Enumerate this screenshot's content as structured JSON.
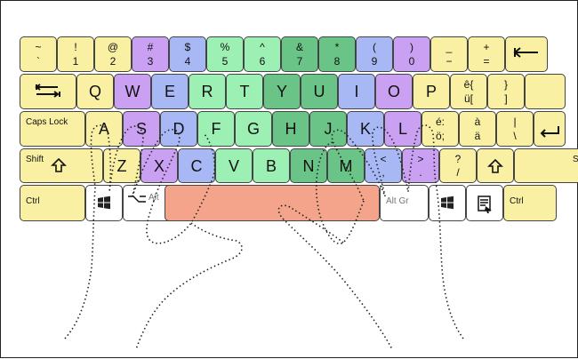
{
  "rows": [
    {
      "name": "number-row",
      "keys": [
        {
          "name": "key-tilde",
          "top": "~",
          "bottom": "`",
          "color": "yellow"
        },
        {
          "name": "key-1",
          "top": "!",
          "bottom": "1",
          "color": "yellow"
        },
        {
          "name": "key-2",
          "top": "@",
          "bottom": "2",
          "color": "yellow"
        },
        {
          "name": "key-3",
          "top": "#",
          "bottom": "3",
          "color": "purple"
        },
        {
          "name": "key-4",
          "top": "$",
          "bottom": "4",
          "color": "blue"
        },
        {
          "name": "key-5",
          "top": "%",
          "bottom": "5",
          "color": "lgreen"
        },
        {
          "name": "key-6",
          "top": "^",
          "bottom": "6",
          "color": "lgreen"
        },
        {
          "name": "key-7",
          "top": "&",
          "bottom": "7",
          "color": "dgreen"
        },
        {
          "name": "key-8",
          "top": "*",
          "bottom": "8",
          "color": "dgreen"
        },
        {
          "name": "key-9",
          "top": "(",
          "bottom": "9",
          "color": "blue"
        },
        {
          "name": "key-0",
          "top": ")",
          "bottom": "0",
          "color": "purple"
        },
        {
          "name": "key-minus",
          "top": "_",
          "bottom": "−",
          "color": "yellow"
        },
        {
          "name": "key-equals",
          "top": "+",
          "bottom": "=",
          "color": "yellow"
        },
        {
          "name": "key-backspace",
          "icon": "backspace-icon",
          "color": "yellow"
        }
      ]
    },
    {
      "name": "qwerty-row",
      "keys": [
        {
          "name": "key-tab",
          "icon": "tab-icon",
          "color": "yellow"
        },
        {
          "name": "key-q",
          "main": "Q",
          "color": "yellow"
        },
        {
          "name": "key-w",
          "main": "W",
          "color": "purple"
        },
        {
          "name": "key-e",
          "main": "E",
          "color": "blue"
        },
        {
          "name": "key-r",
          "main": "R",
          "color": "lgreen"
        },
        {
          "name": "key-t",
          "main": "T",
          "color": "lgreen"
        },
        {
          "name": "key-y",
          "main": "Y",
          "color": "dgreen"
        },
        {
          "name": "key-u",
          "main": "U",
          "color": "dgreen"
        },
        {
          "name": "key-i",
          "main": "I",
          "color": "blue"
        },
        {
          "name": "key-o",
          "main": "O",
          "color": "purple"
        },
        {
          "name": "key-p",
          "main": "P",
          "color": "yellow"
        },
        {
          "name": "key-bracket-left",
          "top": "ê{",
          "bottom": "ü[",
          "color": "yellow"
        },
        {
          "name": "key-bracket-right",
          "top": "}",
          "bottom": "]",
          "color": "yellow"
        },
        {
          "name": "key-enter-upper",
          "color": "yellow"
        }
      ]
    },
    {
      "name": "home-row",
      "keys": [
        {
          "name": "key-caps-lock",
          "label": "Caps Lock",
          "color": "yellow"
        },
        {
          "name": "key-a",
          "main": "A",
          "color": "yellow"
        },
        {
          "name": "key-s",
          "main": "S",
          "color": "purple"
        },
        {
          "name": "key-d",
          "main": "D",
          "color": "blue"
        },
        {
          "name": "key-f",
          "main": "F",
          "color": "lgreen"
        },
        {
          "name": "key-g",
          "main": "G",
          "color": "lgreen"
        },
        {
          "name": "key-h",
          "main": "H",
          "color": "dgreen"
        },
        {
          "name": "key-j",
          "main": "J",
          "color": "dgreen"
        },
        {
          "name": "key-k",
          "main": "K",
          "color": "blue"
        },
        {
          "name": "key-l",
          "main": "L",
          "color": "purple"
        },
        {
          "name": "key-semicolon",
          "top": "é:",
          "bottom": "ö;",
          "color": "yellow"
        },
        {
          "name": "key-quote",
          "top": "à",
          "bottom": "ä",
          "color": "yellow"
        },
        {
          "name": "key-backslash",
          "top": "|",
          "bottom": "\\",
          "color": "yellow"
        },
        {
          "name": "key-enter",
          "icon": "enter-icon",
          "color": "yellow"
        }
      ]
    },
    {
      "name": "shift-row",
      "keys": [
        {
          "name": "key-shift-left",
          "label": "Shift",
          "icon": "shift-icon",
          "color": "yellow"
        },
        {
          "name": "key-z",
          "main": "Z",
          "color": "yellow"
        },
        {
          "name": "key-x",
          "main": "X",
          "color": "purple"
        },
        {
          "name": "key-c",
          "main": "C",
          "color": "blue"
        },
        {
          "name": "key-v",
          "main": "V",
          "color": "lgreen"
        },
        {
          "name": "key-b",
          "main": "B",
          "color": "lgreen"
        },
        {
          "name": "key-n",
          "main": "N",
          "color": "dgreen"
        },
        {
          "name": "key-m",
          "main": "M",
          "color": "dgreen"
        },
        {
          "name": "key-comma",
          "top": "<",
          "bottom": ",",
          "color": "blue"
        },
        {
          "name": "key-period",
          "top": ">",
          "bottom": ".",
          "color": "purple"
        },
        {
          "name": "key-slash",
          "top": "?",
          "bottom": "/",
          "color": "yellow"
        },
        {
          "name": "key-shift-up",
          "icon": "shift-icon",
          "color": "yellow"
        },
        {
          "name": "key-shift-right",
          "label": "Shift",
          "color": "yellow"
        }
      ]
    },
    {
      "name": "bottom-row",
      "keys": [
        {
          "name": "key-ctrl-left",
          "label": "Ctrl",
          "color": "yellow"
        },
        {
          "name": "key-win-left",
          "icon": "windows-icon",
          "color": "white"
        },
        {
          "name": "key-alt",
          "label": "Alt",
          "icon": "alt-icon",
          "color": "white"
        },
        {
          "name": "key-space",
          "color": "salmon"
        },
        {
          "name": "key-alt-gr",
          "label": "Alt Gr",
          "color": "white"
        },
        {
          "name": "key-win-right",
          "icon": "windows-icon",
          "color": "white"
        },
        {
          "name": "key-menu",
          "icon": "menu-icon",
          "color": "white"
        },
        {
          "name": "key-ctrl-right",
          "label": "Ctrl",
          "color": "yellow"
        }
      ]
    }
  ],
  "colors": {
    "yellow": "#f9f0a3",
    "purple": "#c9a0f2",
    "blue": "#a8b8f5",
    "lgreen": "#9cf0b4",
    "dgreen": "#6bc487",
    "white": "#ffffff",
    "salmon": "#f4a48a"
  },
  "overlay": "left-and-right-hands-dotted-outline"
}
